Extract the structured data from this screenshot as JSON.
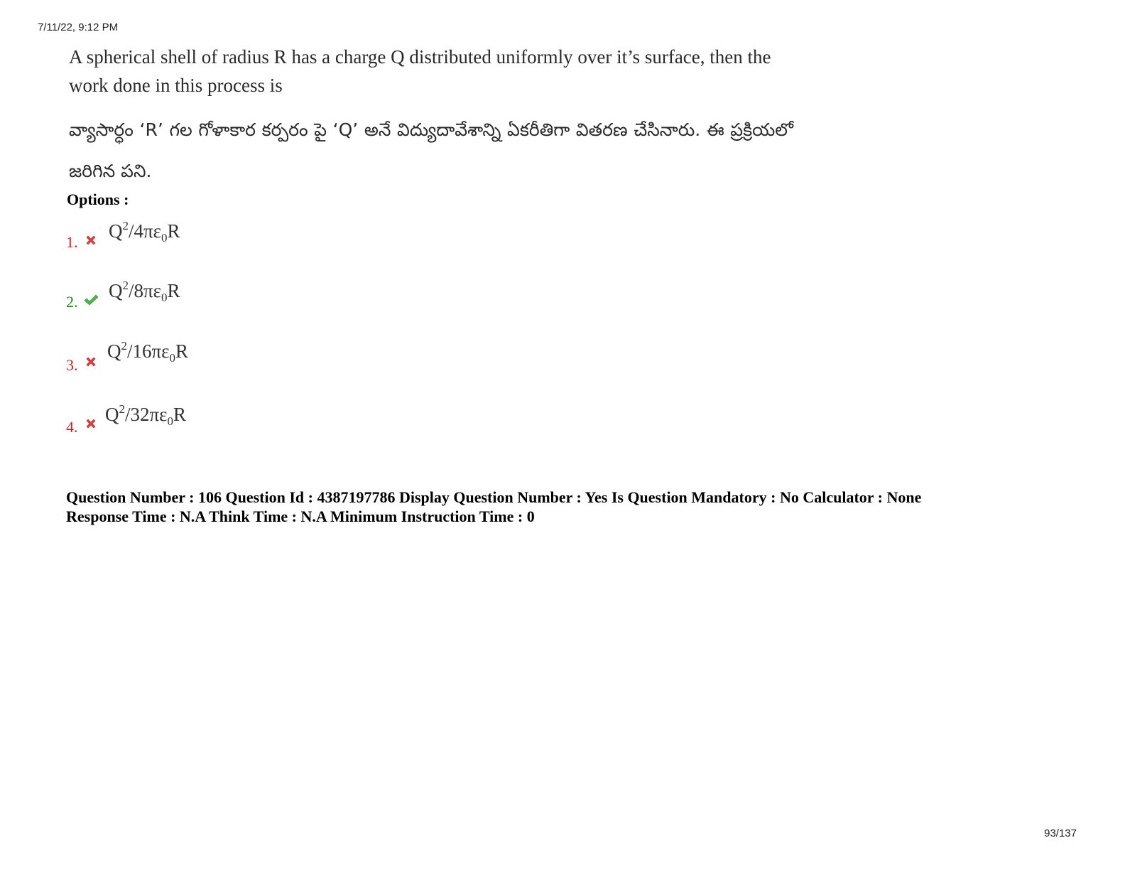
{
  "header": {
    "datetime": "7/11/22, 9:12 PM"
  },
  "footer": {
    "page": "93/137"
  },
  "question": {
    "english": "A spherical shell of radius R has a charge Q distributed uniformly over it’s surface, then the work done in this process is",
    "telugu": "వ్యాసార్ధం ‘R’ గల గోళాకార కర్పరం పై ‘Q’ అనే విద్యుదావేశాన్ని ఏకరీతిగా వితరణ చేసినారు. ఈ ప్రక్రియలో జరిగిన పని."
  },
  "options_label": "Options :",
  "options": [
    {
      "number": "1.",
      "status": "wrong",
      "icon": "cross-icon",
      "base": "Q",
      "exp": "2",
      "mid": "/4πε",
      "sub": "0",
      "end": "R"
    },
    {
      "number": "2.",
      "status": "correct",
      "icon": "check-icon",
      "base": "Q",
      "exp": "2",
      "mid": "/8πε",
      "sub": "0",
      "end": "R"
    },
    {
      "number": "3.",
      "status": "wrong",
      "icon": "cross-icon",
      "base": "Q",
      "exp": "2",
      "mid": "/16πε",
      "sub": "0",
      "end": "R"
    },
    {
      "number": "4.",
      "status": "wrong",
      "icon": "cross-icon",
      "base": "Q",
      "exp": "2",
      "mid": "/32πε",
      "sub": "0",
      "end": "R"
    }
  ],
  "meta": {
    "line1": "Question Number : 106 Question Id : 4387197786 Display Question Number : Yes Is Question Mandatory : No Calculator : None",
    "line2": "Response Time : N.A Think Time : N.A Minimum Instruction Time : 0"
  },
  "colors": {
    "wrong": "#d62020",
    "correct": "#1a8a1a"
  }
}
